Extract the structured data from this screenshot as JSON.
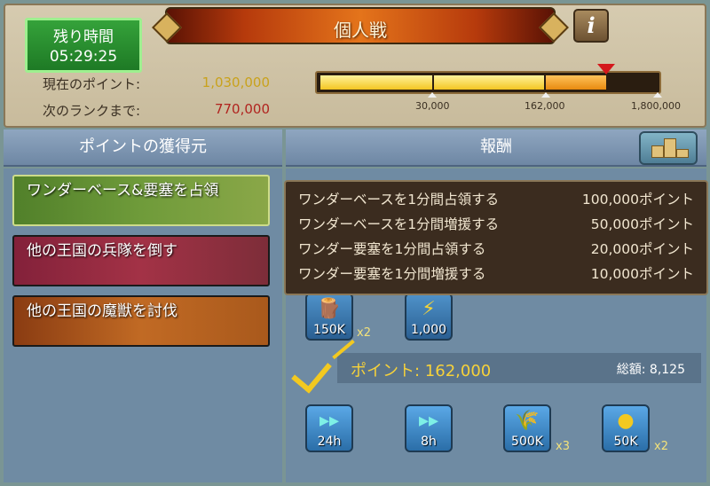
{
  "header": {
    "title": "個人戦",
    "info_label": "i",
    "timer_label": "残り時間",
    "timer_value": "05:29:25",
    "current_points_label": "現在のポイント:",
    "current_points_value": "1,030,000",
    "next_rank_label": "次のランクまで:",
    "next_rank_value": "770,000"
  },
  "progress": {
    "fraction": 0.572,
    "ticks": [
      "30,000",
      "162,000",
      "1,800,000"
    ]
  },
  "sections": {
    "left_title": "ポイントの獲得元",
    "right_title": "報酬"
  },
  "sources": [
    {
      "label": "ワンダーベース&要塞を占領"
    },
    {
      "label": "他の王国の兵隊を倒す"
    },
    {
      "label": "他の王国の魔獣を討伐"
    }
  ],
  "tooltip": {
    "rows": [
      {
        "left": "ワンダーベースを1分間占領する",
        "right": "100,000ポイント"
      },
      {
        "left": "ワンダーベースを1分間増援する",
        "right": "50,000ポイント"
      },
      {
        "left": "ワンダー要塞を1分間占領する",
        "right": "20,000ポイント"
      },
      {
        "left": "ワンダー要塞を1分間増援する",
        "right": "10,000ポイント"
      }
    ]
  },
  "rewards_top": [
    {
      "qty": "150K",
      "mult": "x2",
      "icon": "wood-icon"
    },
    {
      "qty": "1,000",
      "mult": "",
      "icon": "energy-icon"
    }
  ],
  "tier": {
    "points_label": "ポイント: 162,000",
    "total_label": "総額: 8,125"
  },
  "rewards_bottom": [
    {
      "qty": "24h",
      "mult": "",
      "icon": "speedup-icon"
    },
    {
      "qty": "8h",
      "mult": "",
      "icon": "speedup-icon"
    },
    {
      "qty": "500K",
      "mult": "x3",
      "icon": "grain-icon"
    },
    {
      "qty": "50K",
      "mult": "x2",
      "icon": "gold-icon"
    }
  ],
  "colors": {
    "accent_gold": "#f7d23a",
    "timer_green": "#1e7a25",
    "next_rank_red": "#b1241f",
    "points_gold": "#c9a21c"
  }
}
